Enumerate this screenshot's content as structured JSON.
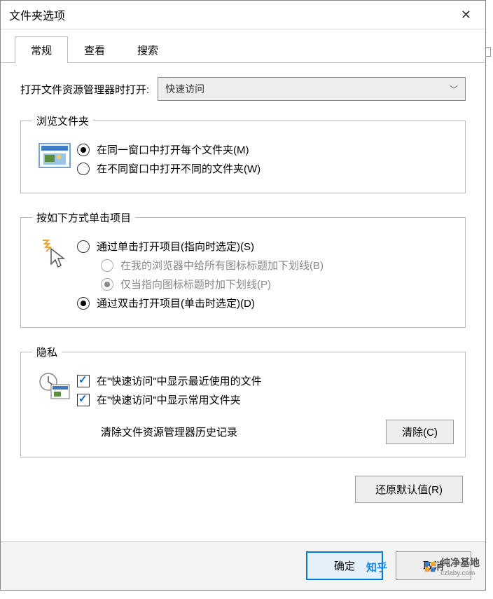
{
  "window": {
    "title": "文件夹选项"
  },
  "tabs": {
    "general": "常规",
    "view": "查看",
    "search": "搜索",
    "active": "general"
  },
  "openWith": {
    "label": "打开文件资源管理器时打开:",
    "value": "快速访问"
  },
  "browse": {
    "legend": "浏览文件夹",
    "opt1": "在同一窗口中打开每个文件夹(M)",
    "opt2": "在不同窗口中打开不同的文件夹(W)"
  },
  "click": {
    "legend": "按如下方式单击项目",
    "opt1": "通过单击打开项目(指向时选定)(S)",
    "sub1": "在我的浏览器中给所有图标标题加下划线(B)",
    "sub2": "仅当指向图标标题时加下划线(P)",
    "opt2": "通过双击打开项目(单击时选定)(D)"
  },
  "privacy": {
    "legend": "隐私",
    "chk1": "在\"快速访问\"中显示最近使用的文件",
    "chk2": "在\"快速访问\"中显示常用文件夹",
    "clearLabel": "清除文件资源管理器历史记录",
    "clearBtn": "清除(C)"
  },
  "buttons": {
    "restore": "还原默认值(R)",
    "ok": "确定",
    "cancel": "取消"
  },
  "watermark": {
    "zhihu": "知乎",
    "brand": "纯净基地",
    "url": "czlaby.com"
  }
}
